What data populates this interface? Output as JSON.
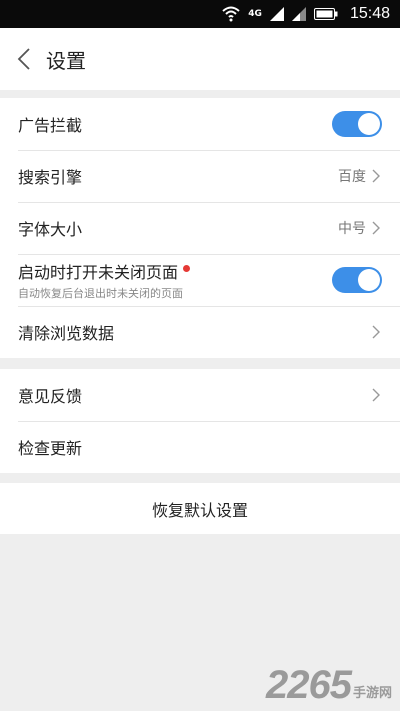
{
  "status_bar": {
    "time": "15:48",
    "network_label": "4G",
    "icons": [
      "wifi-icon",
      "signal-icon",
      "signal-icon",
      "battery-icon"
    ]
  },
  "header": {
    "back_icon": "chevron-left-icon",
    "title": "设置"
  },
  "settings_group_1": {
    "ad_block": {
      "label": "广告拦截",
      "enabled": true
    },
    "search_engine": {
      "label": "搜索引擎",
      "value": "百度"
    },
    "font_size": {
      "label": "字体大小",
      "value": "中号"
    },
    "restore_tabs": {
      "label": "启动时打开未关闭页面",
      "description": "自动恢复后台退出时未关闭的页面",
      "enabled": true,
      "badge_color": "#e53935"
    },
    "clear_data": {
      "label": "清除浏览数据"
    }
  },
  "settings_group_2": {
    "feedback": {
      "label": "意见反馈"
    },
    "check_update": {
      "label": "检查更新"
    }
  },
  "reset": {
    "label": "恢复默认设置"
  },
  "watermark": {
    "number": "2265",
    "text": "手游网"
  },
  "colors": {
    "accent": "#3d8fe8",
    "background": "#eeeeee"
  }
}
